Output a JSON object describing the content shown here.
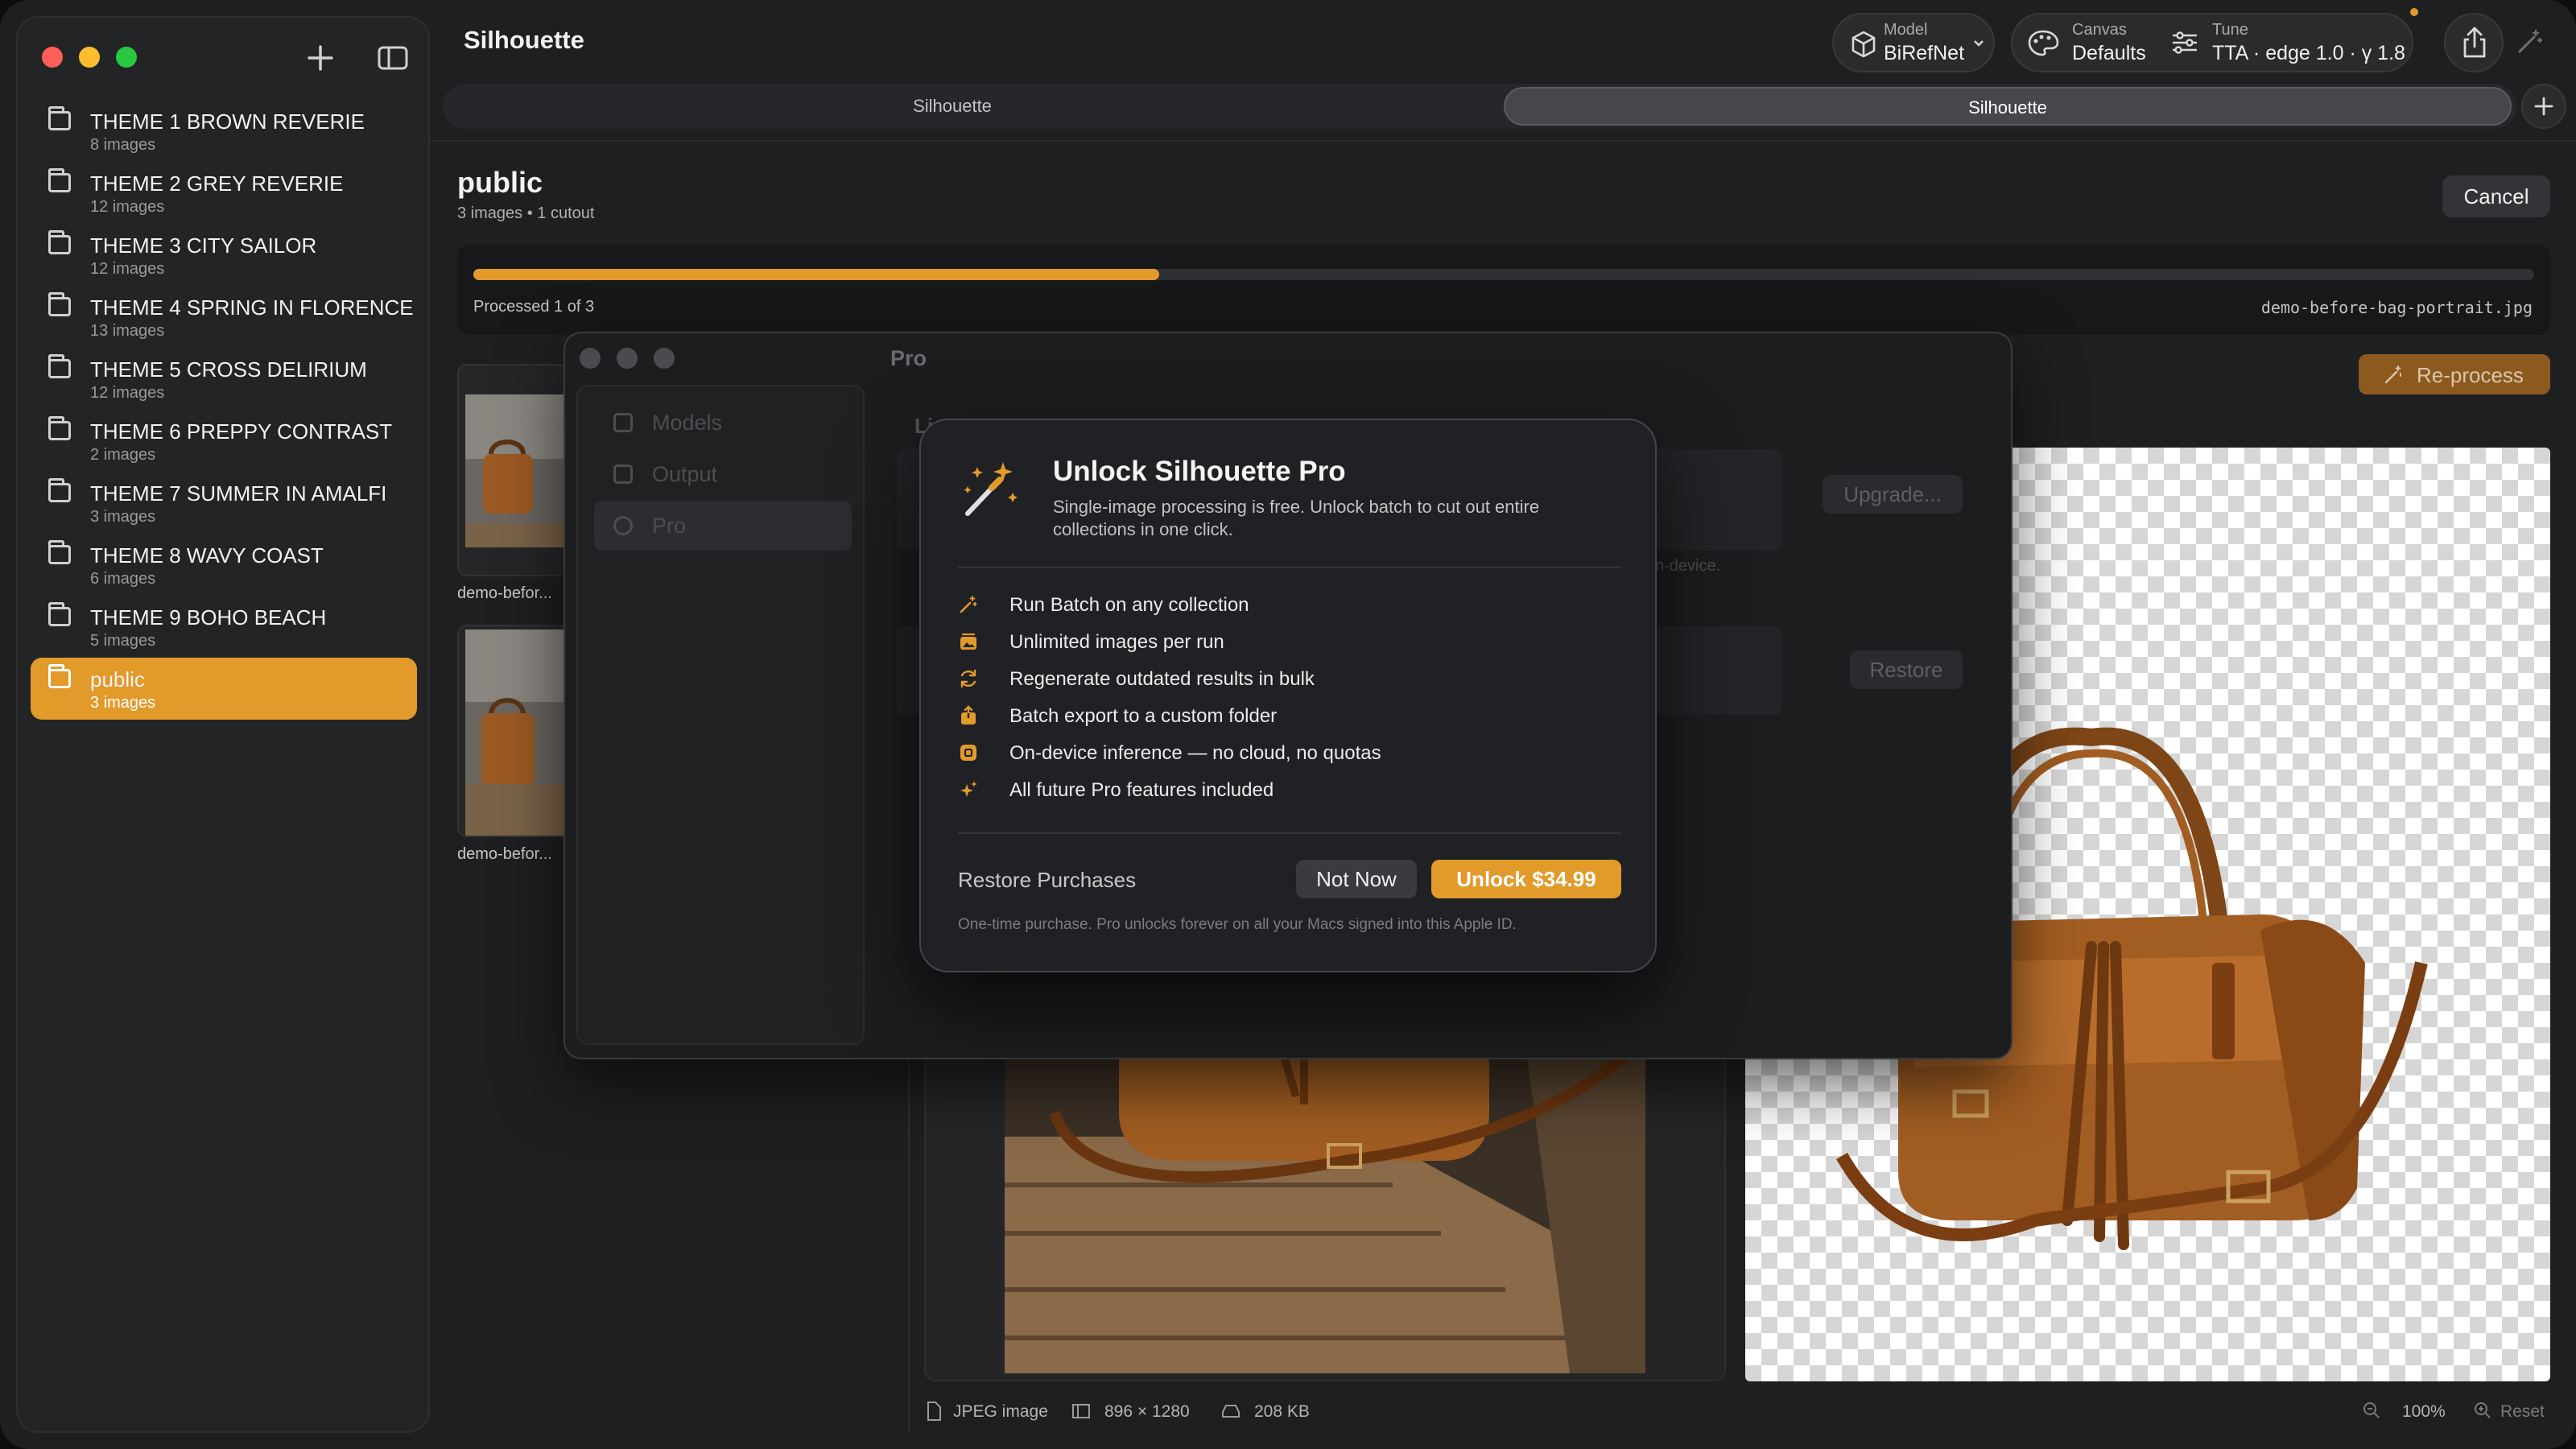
{
  "app": {
    "title": "Silhouette"
  },
  "toolbar": {
    "model": {
      "label": "Model",
      "value": "BiRefNet"
    },
    "canvas": {
      "label": "Canvas",
      "value": "Defaults"
    },
    "tune": {
      "label": "Tune",
      "value": "TTA · edge 1.0 · γ 1.8"
    }
  },
  "tabs": [
    {
      "label": "Silhouette",
      "active": false
    },
    {
      "label": "Silhouette",
      "active": true
    }
  ],
  "sidebar": {
    "items": [
      {
        "name": "THEME 1 BROWN REVERIE",
        "count": "8 images"
      },
      {
        "name": "THEME 2 GREY REVERIE",
        "count": "12 images"
      },
      {
        "name": "THEME 3 CITY SAILOR",
        "count": "12 images"
      },
      {
        "name": "THEME 4 SPRING IN FLORENCE",
        "count": "13 images"
      },
      {
        "name": "THEME 5 CROSS DELIRIUM",
        "count": "12 images"
      },
      {
        "name": "THEME 6 PREPPY CONTRAST",
        "count": "2 images"
      },
      {
        "name": "THEME 7 SUMMER IN AMALFI",
        "count": "3 images"
      },
      {
        "name": "THEME 8 WAVY COAST",
        "count": "6 images"
      },
      {
        "name": "THEME 9 BOHO BEACH",
        "count": "5 images"
      },
      {
        "name": "public",
        "count": "3 images",
        "active": true
      }
    ]
  },
  "collection": {
    "title": "public",
    "subtitle": "3 images • 1 cutout",
    "cancel_label": "Cancel",
    "reprocess_label": "Re-process",
    "progress": {
      "fraction": 0.333,
      "text": "Processed 1 of 3",
      "file": "demo-before-bag-portrait.jpg"
    },
    "thumbs": [
      {
        "name": "demo-befor..."
      },
      {
        "name": "demo-befor..."
      }
    ]
  },
  "status": {
    "type": "JPEG image",
    "dimensions": "896 × 1280",
    "size": "208 KB",
    "zoom": "100%",
    "reset": "Reset"
  },
  "settings": {
    "title": "Pro",
    "nav": [
      {
        "label": "Models"
      },
      {
        "label": "Output"
      },
      {
        "label": "Pro",
        "active": true
      }
    ],
    "section_label": "Li",
    "upgrade_label": "Upgrade...",
    "note": "n-device.",
    "restore_label": "Restore"
  },
  "dialog": {
    "title": "Unlock Silhouette Pro",
    "subtitle": "Single-image processing is free. Unlock batch to cut out entire collections in one click.",
    "features": [
      {
        "icon": "wand-icon",
        "text": "Run Batch on any collection"
      },
      {
        "icon": "photo-stack-icon",
        "text": "Unlimited images per run"
      },
      {
        "icon": "refresh-icon",
        "text": "Regenerate outdated results in bulk"
      },
      {
        "icon": "export-icon",
        "text": "Batch export to a custom folder"
      },
      {
        "icon": "chip-icon",
        "text": "On-device inference — no cloud, no quotas"
      },
      {
        "icon": "sparkles-icon",
        "text": "All future Pro features included"
      }
    ],
    "restore_label": "Restore Purchases",
    "not_now_label": "Not Now",
    "unlock_label": "Unlock $34.99",
    "footnote": "One-time purchase. Pro unlocks forever on all your Macs signed into this Apple ID."
  },
  "colors": {
    "accent": "#e29a2b",
    "background": "#1e1f21"
  }
}
